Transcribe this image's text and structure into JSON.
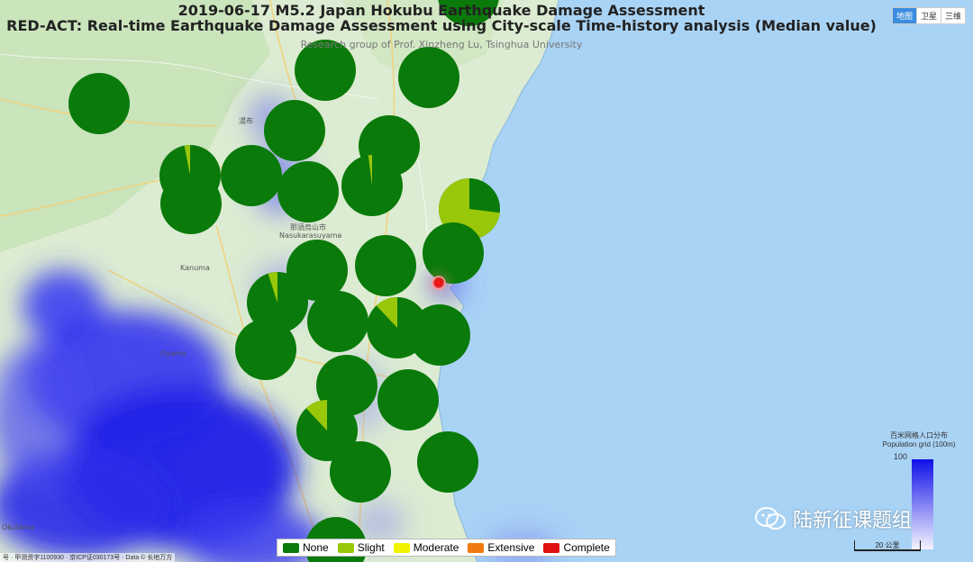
{
  "title": "2019-06-17 M5.2 Japan Hokubu Earthquake Damage Assessment",
  "subtitle": "RED-ACT: Real-time Earthquake Damage Assessment using City-scale Time-history analysis (Median value)",
  "credit": "Research group of Prof. Xinzheng Lu, Tsinghua University",
  "map_types": [
    "地图",
    "卫星",
    "三维"
  ],
  "place_labels": [
    {
      "name": "湯布",
      "key": "yufu"
    },
    {
      "name": "那須烏山市",
      "key": "nasu_jp"
    },
    {
      "name": "Nasukarasuyama",
      "key": "nasu_en"
    },
    {
      "name": "Kanuma",
      "key": "kanuma"
    },
    {
      "name": "Oyama",
      "key": "oyama"
    },
    {
      "name": "Okutama",
      "key": "okutama"
    }
  ],
  "legend": [
    {
      "label": "None",
      "color": "#0a7a0a"
    },
    {
      "label": "Slight",
      "color": "#99c70a"
    },
    {
      "label": "Moderate",
      "color": "#f2f200"
    },
    {
      "label": "Extensive",
      "color": "#f07a10"
    },
    {
      "label": "Complete",
      "color": "#e01010"
    }
  ],
  "population": {
    "title_cn": "百米网格人口分布",
    "title_en": "Population grid (100m)",
    "max": "100"
  },
  "scale_label": "20 公里",
  "copyright": "号 · 甲测资字1100930 · 京ICP证030173号 · Data © 长地万方",
  "watermark": "陆新征课题组",
  "epicenter": {
    "label": "Epicenter"
  },
  "cities": [
    {
      "id": 1,
      "slight": 0
    },
    {
      "id": 2,
      "slight": 0
    },
    {
      "id": 3,
      "slight": 0
    },
    {
      "id": 4,
      "slight": 0
    },
    {
      "id": 5,
      "slight": 0
    },
    {
      "id": 6,
      "slight": 0
    },
    {
      "id": 7,
      "slight": 0.03
    },
    {
      "id": 8,
      "slight": 0
    },
    {
      "id": 9,
      "slight": 0
    },
    {
      "id": 10,
      "slight": 0
    },
    {
      "id": 11,
      "slight": 0.02
    },
    {
      "id": 12,
      "slight": 0.73
    },
    {
      "id": 13,
      "slight": 0
    },
    {
      "id": 14,
      "slight": 0
    },
    {
      "id": 15,
      "slight": 0
    },
    {
      "id": 16,
      "slight": 0.05
    },
    {
      "id": 17,
      "slight": 0
    },
    {
      "id": 18,
      "slight": 0.12
    },
    {
      "id": 19,
      "slight": 0
    },
    {
      "id": 20,
      "slight": 0
    },
    {
      "id": 21,
      "slight": 0
    },
    {
      "id": 22,
      "slight": 0
    },
    {
      "id": 23,
      "slight": 0.12
    },
    {
      "id": 24,
      "slight": 0
    },
    {
      "id": 25,
      "slight": 0
    },
    {
      "id": 26,
      "slight": 0
    },
    {
      "id": 27,
      "slight": 0
    }
  ]
}
